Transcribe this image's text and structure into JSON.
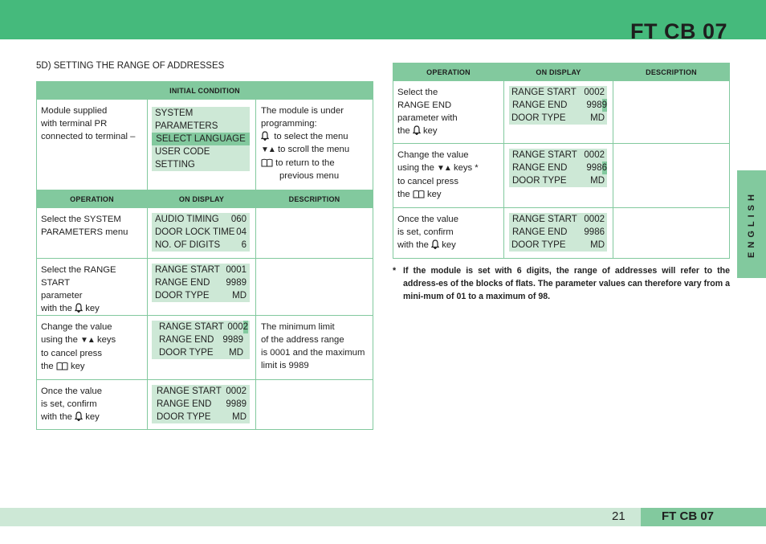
{
  "header": {
    "title": "FT CB 07"
  },
  "section_title": "5D) SETTING THE RANGE OF ADDRESSES",
  "left_table": {
    "initial_condition_label": "INITIAL CONDITION",
    "initial": {
      "operation": [
        "Module supplied",
        "with terminal PR",
        "connected to terminal –"
      ],
      "display": [
        {
          "label": "SYSTEM PARAMETERS",
          "value": "",
          "highlight": false
        },
        {
          "label": "SELECT LANGUAGE",
          "value": "",
          "highlight": true
        },
        {
          "label": "USER CODE SETTING",
          "value": "",
          "highlight": false
        }
      ],
      "description": {
        "line1": "The module is under",
        "line2": "programming:",
        "bell_text": "to select the menu",
        "arrows_text": "to scroll the menu",
        "book_text": "to return to the",
        "book_text2": "previous menu"
      }
    },
    "headers": {
      "operation": "OPERATION",
      "display": "ON DISPLAY",
      "description": "DESCRIPTION"
    },
    "rows": [
      {
        "operation": [
          "Select the SYSTEM",
          "PARAMETERS menu"
        ],
        "display": [
          {
            "label": "AUDIO TIMING",
            "value": "060"
          },
          {
            "label": "DOOR LOCK TIME",
            "value": "04"
          },
          {
            "label": "NO. OF DIGITS",
            "value": "6"
          }
        ],
        "description": []
      },
      {
        "operation": [
          "Select the RANGE START",
          "parameter",
          "with the",
          "key"
        ],
        "display": [
          {
            "label": "RANGE START",
            "value": "0001"
          },
          {
            "label": "RANGE END",
            "value": "9989"
          },
          {
            "label": "DOOR TYPE",
            "value": "MD"
          }
        ],
        "description": []
      },
      {
        "operation": [
          "Change the value",
          "using the",
          "keys",
          "to cancel press",
          "the",
          "key"
        ],
        "display": [
          {
            "label": "RANGE START",
            "value": "000",
            "cursor": "2"
          },
          {
            "label": "RANGE END",
            "value": "9989"
          },
          {
            "label": "DOOR TYPE",
            "value": "MD"
          }
        ],
        "description": [
          "The minimum limit",
          "of the address range",
          "is 0001 and the maximum",
          "limit is 9989"
        ]
      },
      {
        "operation": [
          "Once the  value",
          "is set, confirm",
          "with the",
          "key"
        ],
        "display": [
          {
            "label": "RANGE START",
            "value": "0002"
          },
          {
            "label": "RANGE END",
            "value": "9989"
          },
          {
            "label": "DOOR TYPE",
            "value": "MD"
          }
        ],
        "description": []
      }
    ]
  },
  "right_table": {
    "headers": {
      "operation": "OPERATION",
      "display": "ON DISPLAY",
      "description": "DESCRIPTION"
    },
    "rows": [
      {
        "operation": [
          "Select the",
          "RANGE END",
          "parameter with",
          "the",
          "key"
        ],
        "display": [
          {
            "label": "RANGE START",
            "value": "0002"
          },
          {
            "label": "RANGE END",
            "value": "998",
            "cursor": "9"
          },
          {
            "label": "DOOR TYPE",
            "value": "MD"
          }
        ]
      },
      {
        "operation": [
          "Change the value",
          "using the",
          "keys *",
          "to cancel press",
          "the",
          "key"
        ],
        "display": [
          {
            "label": "RANGE START",
            "value": "0002"
          },
          {
            "label": "RANGE END",
            "value": "998",
            "cursor": "6"
          },
          {
            "label": "DOOR TYPE",
            "value": "MD"
          }
        ]
      },
      {
        "operation": [
          "Once the  value",
          "is set, confirm",
          "with the",
          "key"
        ],
        "display": [
          {
            "label": "RANGE START",
            "value": "0002"
          },
          {
            "label": "RANGE END",
            "value": "9986"
          },
          {
            "label": "DOOR TYPE",
            "value": "MD"
          }
        ]
      }
    ]
  },
  "footnote": {
    "star": "*",
    "text": "If the module is set with 6 digits, the range of addresses will refer to the address-es of the blocks of flats. The parameter values can therefore vary from a mini-mum of 01 to a maximum of 98."
  },
  "language_tab": "ENGLISH",
  "footer": {
    "page_number": "21",
    "brand": "FT CB 07"
  },
  "icons": {
    "bell": "bell-key-icon",
    "arrows": "down-up-arrow-keys-icon",
    "book": "book-key-icon"
  },
  "colors": {
    "brand_green": "#45ba7c",
    "table_green": "#82c99e",
    "light_green": "#cde8d6"
  }
}
